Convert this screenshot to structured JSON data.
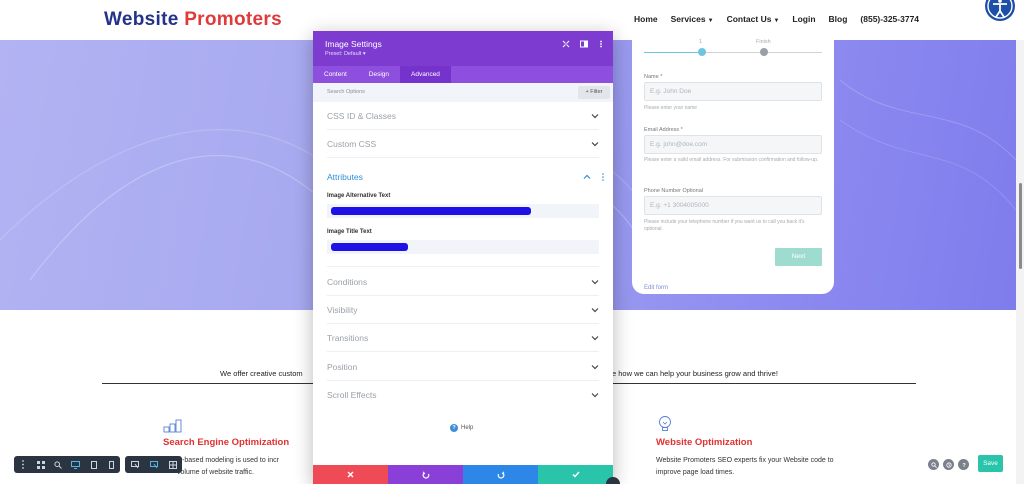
{
  "site": {
    "logo_part1": "Website",
    "logo_part2": "Promoters",
    "nav": {
      "home": "Home",
      "services": "Services",
      "contact": "Contact Us",
      "login": "Login",
      "blog": "Blog",
      "phone": "(855)-325-3774"
    }
  },
  "form": {
    "progress_label_finish": "Finish",
    "progress_label_start": "1",
    "progress_fraction": 0.33,
    "name_label": "Name *",
    "name_placeholder": "E.g. John Doe",
    "name_help": "Please enter your name",
    "email_label": "Email Address *",
    "email_placeholder": "E.g. john@doe.com",
    "email_help": "Please enter a valid email address. For submission confirmation and follow-up.",
    "phone_label": "Phone Number Optional",
    "phone_placeholder": "E.g. +1 3004005000",
    "phone_help": "Please include your telephone number if you want us to call you back it's optional.",
    "next_label": "Next",
    "edit_label": "Edit form"
  },
  "page": {
    "tagline_left": "We offer creative custom",
    "tagline_right": "e how we can help your business grow and thrive!",
    "services": [
      {
        "title": "Search Engine Optimization",
        "line1": "uter-based modeling is used to incr",
        "line2": "volume of website traffic."
      },
      {
        "title": "Website Optimization",
        "line1": "Website Promoters SEO experts fix your Website code to",
        "line2": "improve page load times."
      }
    ]
  },
  "modal": {
    "title": "Image Settings",
    "preset": "Preset: Default ▾",
    "tabs": [
      "Content",
      "Design",
      "Advanced"
    ],
    "active_tab": "Advanced",
    "search_placeholder": "Search Options",
    "filter_label": "+ Filter",
    "sections": {
      "css_id": "CSS ID & Classes",
      "custom_css": "Custom CSS",
      "attributes": "Attributes",
      "conditions": "Conditions",
      "visibility": "Visibility",
      "transitions": "Transitions",
      "position": "Position",
      "scroll_effects": "Scroll Effects"
    },
    "alt_text_label": "Image Alternative Text",
    "title_text_label": "Image Title Text",
    "help_label": "Help"
  },
  "toolbar": {
    "save_label": "Save"
  },
  "colors": {
    "modal_header": "#7e3bd0",
    "tab_bar": "#8f4fde",
    "accent_blue": "#2e8fd8",
    "cancel": "#ef4b56",
    "undo": "#8a3fd9",
    "redo": "#2d87e8",
    "confirm": "#29c4a9",
    "save": "#29c4a9",
    "brand_red": "#e03131"
  }
}
